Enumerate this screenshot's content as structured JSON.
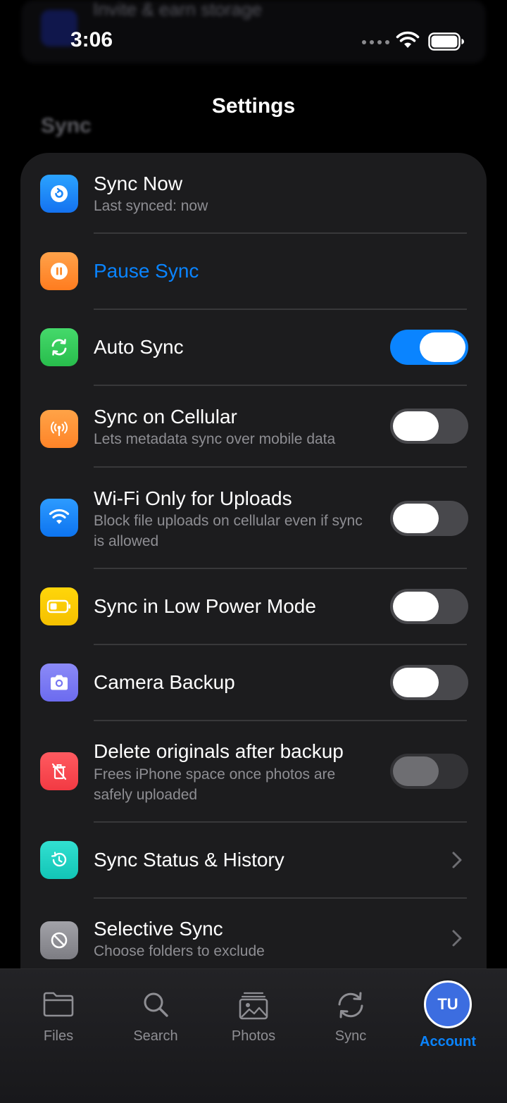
{
  "status_bar": {
    "time": "3:06"
  },
  "background": {
    "banner_title": "Invite & earn storage",
    "section_label": "Sync"
  },
  "header": {
    "title": "Settings"
  },
  "colors": {
    "accent": "#0a84ff",
    "card": "#1c1c1e",
    "background": "#000000"
  },
  "rows": [
    {
      "title": "Sync Now",
      "subtitle": "Last synced: now",
      "icon": "sync-now-icon",
      "color": "#1e90ff"
    },
    {
      "title": "Pause Sync",
      "icon": "pause-icon",
      "color": "#ff8c2a"
    },
    {
      "title": "Auto Sync",
      "icon": "auto-sync-icon",
      "color": "#34c759",
      "toggle": true
    },
    {
      "title": "Sync on Cellular",
      "subtitle": "Lets metadata sync over mobile data",
      "icon": "cellular-icon",
      "color": "#ff9230",
      "toggle": false
    },
    {
      "title": "Wi-Fi Only for Uploads",
      "subtitle": "Block file uploads on cellular even if sync is allowed",
      "icon": "wifi-icon",
      "color": "#0a84ff",
      "toggle": false
    },
    {
      "title": "Sync in Low Power Mode",
      "icon": "battery-icon",
      "color": "#ffcc00",
      "toggle": false
    },
    {
      "title": "Camera Backup",
      "icon": "camera-icon",
      "color": "#7d7cf5",
      "toggle": false
    },
    {
      "title": "Delete originals after backup",
      "subtitle": "Frees iPhone space once photos are safely uploaded",
      "icon": "trash-icon",
      "color": "#ff4d55",
      "toggle": false,
      "disabled": true
    },
    {
      "title": "Sync Status & History",
      "icon": "history-icon",
      "color": "#22d3c5"
    },
    {
      "title": "Selective Sync",
      "subtitle": "Choose folders to exclude",
      "icon": "exclude-icon",
      "color": "#8e8e93"
    }
  ],
  "tabs": [
    {
      "label": "Files",
      "icon": "folder-icon"
    },
    {
      "label": "Search",
      "icon": "search-icon"
    },
    {
      "label": "Photos",
      "icon": "photos-icon"
    },
    {
      "label": "Sync",
      "icon": "sync-icon"
    },
    {
      "label": "Account",
      "icon": "avatar",
      "initials": "TU",
      "active": true
    }
  ]
}
